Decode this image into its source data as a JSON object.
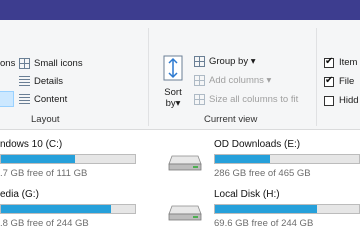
{
  "ribbon": {
    "layout": {
      "icons_partial": "ons",
      "small_icons": "Small icons",
      "details": "Details",
      "content": "Content",
      "group_label": "Layout"
    },
    "current_view": {
      "sort_line1": "Sort",
      "sort_line2": "by▾",
      "group_by": "Group by ▾",
      "add_columns": "Add columns ▾",
      "size_all_columns": "Size all columns to fit",
      "group_label": "Current view"
    },
    "show_hide": {
      "item_checkboxes": "Item",
      "item_checked": true,
      "file_name_extensions": "File",
      "file_checked": true,
      "hidden_items": "Hidd",
      "hidden_checked": false
    }
  },
  "drives": [
    {
      "name": "ndows 10 (C:)",
      "free_text": ".7 GB free of 111 GB",
      "used_fraction": 0.55
    },
    {
      "name": "OD Downloads  (E:)",
      "free_text": "286 GB free of 465 GB",
      "used_fraction": 0.38
    },
    {
      "name": "edia (G:)",
      "free_text": ".8 GB free of 244 GB",
      "used_fraction": 0.82
    },
    {
      "name": "Local Disk (H:)",
      "free_text": "69.6 GB free of 244 GB",
      "used_fraction": 0.71
    }
  ],
  "colors": {
    "accent": "#26a0da",
    "titlebar": "#3d3d8f",
    "selection": "#cce8ff"
  }
}
